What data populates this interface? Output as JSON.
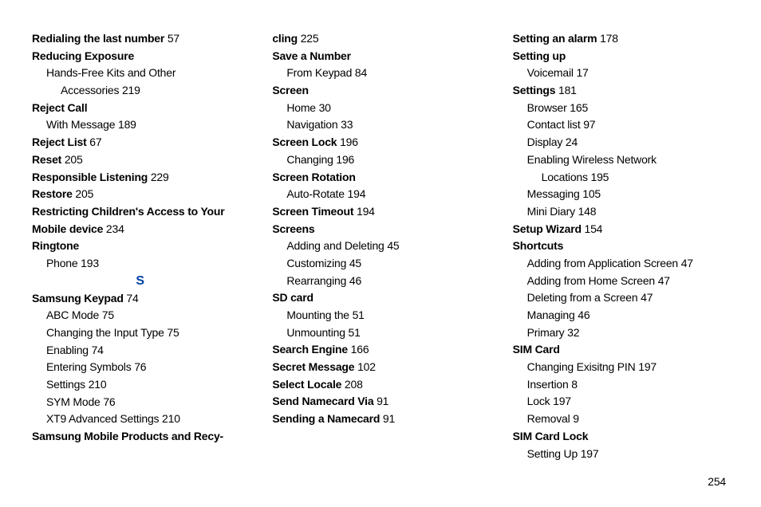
{
  "page_number": "254",
  "col1": [
    {
      "type": "line",
      "bold": "Redialing the last number",
      "page": "57"
    },
    {
      "type": "line",
      "bold": "Reducing Exposure"
    },
    {
      "type": "sub",
      "text": "Hands-Free Kits and Other"
    },
    {
      "type": "sub2",
      "text": "Accessories",
      "page": "219"
    },
    {
      "type": "line",
      "bold": "Reject Call"
    },
    {
      "type": "sub",
      "text": "With Message",
      "page": "189"
    },
    {
      "type": "line",
      "bold": "Reject List",
      "page": "67"
    },
    {
      "type": "line",
      "bold": "Reset",
      "page": "205"
    },
    {
      "type": "line",
      "bold": "Responsible Listening",
      "page": "229"
    },
    {
      "type": "line",
      "bold": "Restore",
      "page": "205"
    },
    {
      "type": "line",
      "bold": "Restricting Children's Access to Your"
    },
    {
      "type": "line",
      "bold": "Mobile device",
      "page": "234"
    },
    {
      "type": "line",
      "bold": "Ringtone"
    },
    {
      "type": "sub",
      "text": "Phone",
      "page": "193"
    },
    {
      "type": "letter",
      "text": "S"
    },
    {
      "type": "line",
      "bold": "Samsung Keypad",
      "page": "74"
    },
    {
      "type": "sub",
      "text": "ABC Mode",
      "page": "75"
    },
    {
      "type": "sub",
      "text": "Changing the Input Type",
      "page": "75"
    },
    {
      "type": "sub",
      "text": "Enabling",
      "page": "74"
    },
    {
      "type": "sub",
      "text": "Entering Symbols",
      "page": "76"
    },
    {
      "type": "sub",
      "text": "Settings",
      "page": "210"
    },
    {
      "type": "sub",
      "text": "SYM Mode",
      "page": "76"
    },
    {
      "type": "sub",
      "text": "XT9 Advanced Settings",
      "page": "210"
    },
    {
      "type": "line",
      "bold": "Samsung Mobile Products and Recy-"
    }
  ],
  "col2": [
    {
      "type": "line",
      "bold": "cling",
      "page": "225"
    },
    {
      "type": "line",
      "bold": "Save a Number"
    },
    {
      "type": "sub",
      "text": "From Keypad",
      "page": "84"
    },
    {
      "type": "line",
      "bold": "Screen"
    },
    {
      "type": "sub",
      "text": "Home",
      "page": "30"
    },
    {
      "type": "sub",
      "text": "Navigation",
      "page": "33"
    },
    {
      "type": "line",
      "bold": "Screen Lock",
      "page": "196"
    },
    {
      "type": "sub",
      "text": "Changing",
      "page": "196"
    },
    {
      "type": "line",
      "bold": "Screen Rotation"
    },
    {
      "type": "sub",
      "text": "Auto-Rotate",
      "page": "194"
    },
    {
      "type": "line",
      "bold": "Screen Timeout",
      "page": "194"
    },
    {
      "type": "line",
      "bold": "Screens"
    },
    {
      "type": "sub",
      "text": "Adding and Deleting",
      "page": "45"
    },
    {
      "type": "sub",
      "text": "Customizing",
      "page": "45"
    },
    {
      "type": "sub",
      "text": "Rearranging",
      "page": "46"
    },
    {
      "type": "line",
      "bold": "SD card"
    },
    {
      "type": "sub",
      "text": "Mounting the",
      "page": "51"
    },
    {
      "type": "sub",
      "text": "Unmounting",
      "page": "51"
    },
    {
      "type": "line",
      "bold": "Search Engine",
      "page": "166"
    },
    {
      "type": "line",
      "bold": "Secret Message",
      "page": "102"
    },
    {
      "type": "line",
      "bold": "Select Locale",
      "page": "208"
    },
    {
      "type": "line",
      "bold": "Send Namecard Via",
      "page": "91"
    },
    {
      "type": "line",
      "bold": "Sending a Namecard",
      "page": "91"
    }
  ],
  "col3": [
    {
      "type": "line",
      "bold": "Setting an alarm",
      "page": "178"
    },
    {
      "type": "line",
      "bold": "Setting up"
    },
    {
      "type": "sub",
      "text": "Voicemail",
      "page": "17"
    },
    {
      "type": "line",
      "bold": "Settings",
      "page": "181"
    },
    {
      "type": "sub",
      "text": "Browser",
      "page": "165"
    },
    {
      "type": "sub",
      "text": "Contact list",
      "page": "97"
    },
    {
      "type": "sub",
      "text": "Display",
      "page": "24"
    },
    {
      "type": "sub",
      "text": "Enabling Wireless Network"
    },
    {
      "type": "sub2",
      "text": "Locations",
      "page": "195"
    },
    {
      "type": "sub",
      "text": "Messaging",
      "page": "105"
    },
    {
      "type": "sub",
      "text": "Mini Diary",
      "page": "148"
    },
    {
      "type": "line",
      "bold": "Setup Wizard",
      "page": "154"
    },
    {
      "type": "line",
      "bold": "Shortcuts"
    },
    {
      "type": "sub",
      "text": "Adding from Application Screen",
      "page": "47"
    },
    {
      "type": "sub",
      "text": "Adding from Home Screen",
      "page": "47"
    },
    {
      "type": "sub",
      "text": "Deleting from a Screen",
      "page": "47"
    },
    {
      "type": "sub",
      "text": "Managing",
      "page": "46"
    },
    {
      "type": "sub",
      "text": "Primary",
      "page": "32"
    },
    {
      "type": "line",
      "bold": "SIM Card"
    },
    {
      "type": "sub",
      "text": "Changing Exisitng PIN",
      "page": "197"
    },
    {
      "type": "sub",
      "text": "Insertion",
      "page": "8"
    },
    {
      "type": "sub",
      "text": "Lock",
      "page": "197"
    },
    {
      "type": "sub",
      "text": "Removal",
      "page": "9"
    },
    {
      "type": "line",
      "bold": "SIM Card Lock"
    },
    {
      "type": "sub",
      "text": "Setting Up",
      "page": "197"
    }
  ]
}
